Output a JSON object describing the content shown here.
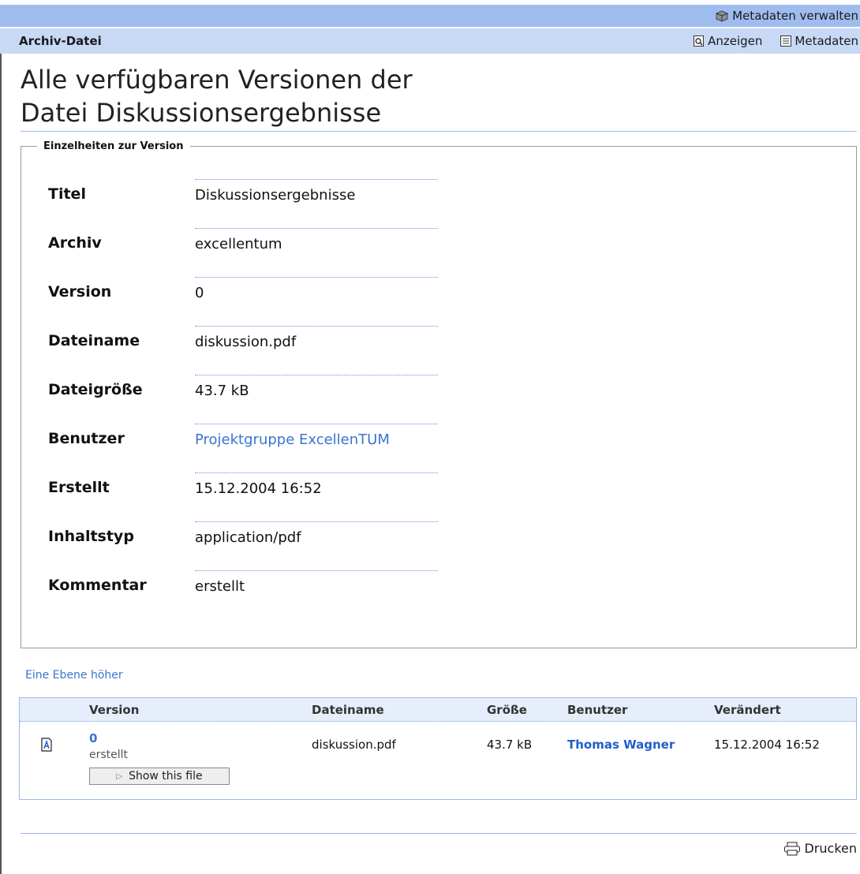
{
  "header": {
    "manage_metadata_label": "Metadaten verwalten",
    "section_title": "Archiv-Datei",
    "view_label": "Anzeigen",
    "metadata_label": "Metadaten"
  },
  "page": {
    "title_line1": "Alle verfügbaren Versionen der",
    "title_line2": "Datei Diskussionsergebnisse"
  },
  "details": {
    "legend": "Einzelheiten zur Version",
    "rows": [
      {
        "label": "Titel",
        "value": "Diskussionsergebnisse"
      },
      {
        "label": "Archiv",
        "value": "excellentum"
      },
      {
        "label": "Version",
        "value": "0"
      },
      {
        "label": "Dateiname",
        "value": "diskussion.pdf"
      },
      {
        "label": "Dateigröße",
        "value": "43.7 kB"
      },
      {
        "label": "Benutzer",
        "value": "Projektgruppe ExcellenTUM"
      },
      {
        "label": "Erstellt",
        "value": "15.12.2004 16:52"
      },
      {
        "label": "Inhaltstyp",
        "value": "application/pdf"
      },
      {
        "label": "Kommentar",
        "value": "erstellt"
      }
    ]
  },
  "nav": {
    "up_link": "Eine Ebene höher"
  },
  "versions": {
    "columns": [
      "Version",
      "Dateiname",
      "Größe",
      "Benutzer",
      "Verändert"
    ],
    "rows": [
      {
        "version": "0",
        "comment": "erstellt",
        "filename": "diskussion.pdf",
        "size": "43.7 kB",
        "user": "Thomas Wagner",
        "changed": "15.12.2004 16:52",
        "button": "Show this file"
      }
    ]
  },
  "footer": {
    "print_label": "Drucken"
  },
  "colors": {
    "topbar": "#9fbcef",
    "subbar": "#c8d9f6",
    "link": "#3a74cf"
  }
}
